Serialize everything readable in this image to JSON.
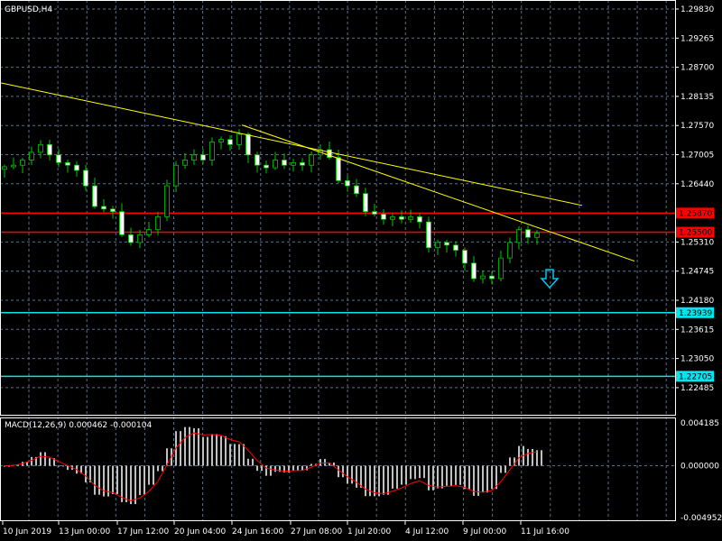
{
  "symbol_title": "GBPUSD,H4",
  "colors": {
    "background": "#000000",
    "grid": "#5f6f87",
    "bull": "#00c800",
    "bear_body": "#ffffff",
    "resistance": "#ff0000",
    "support": "#00e5ee",
    "trendline": "#ffff00",
    "macd_hist": "#c0c0c0",
    "signal": "#ff0000"
  },
  "chart_data": {
    "type": "candlestick",
    "price_ticks": [
      "1.29830",
      "1.29265",
      "1.28700",
      "1.28135",
      "1.27570",
      "1.27005",
      "1.26440",
      "1.25310",
      "1.24745",
      "1.24180",
      "1.23615",
      "1.23050",
      "1.22485"
    ],
    "price_range": [
      1.22,
      1.3
    ],
    "time_labels": [
      "10 Jun 2019",
      "13 Jun 00:00",
      "17 Jun 12:00",
      "20 Jun 04:00",
      "24 Jun 16:00",
      "27 Jun 08:00",
      "1 Jul 20:00",
      "4 Jul 12:00",
      "9 Jul 00:00",
      "11 Jul 16:00"
    ],
    "closes": [
      1.2677,
      1.268,
      1.269,
      1.2705,
      1.272,
      1.27,
      1.2685,
      1.268,
      1.267,
      1.264,
      1.26,
      1.2595,
      1.259,
      1.2545,
      1.253,
      1.2545,
      1.2555,
      1.258,
      1.264,
      1.268,
      1.269,
      1.27,
      1.269,
      1.2725,
      1.273,
      1.272,
      1.274,
      1.27,
      1.268,
      1.2675,
      1.269,
      1.268,
      1.2685,
      1.268,
      1.27,
      1.271,
      1.2695,
      1.265,
      1.264,
      1.2625,
      1.259,
      1.2585,
      1.2575,
      1.258,
      1.2575,
      1.258,
      1.257,
      1.252,
      1.253,
      1.2525,
      1.2515,
      1.249,
      1.246,
      1.2465,
      1.246,
      1.25,
      1.253,
      1.2555,
      1.254,
      1.2548
    ],
    "horizontal_levels": [
      {
        "price": "1.25870",
        "value": 1.2587,
        "kind": "resistance"
      },
      {
        "price": "1.25500",
        "value": 1.255,
        "kind": "resistance"
      },
      {
        "price": "1.23939",
        "value": 1.23939,
        "kind": "support"
      },
      {
        "price": "1.22705",
        "value": 1.22705,
        "kind": "support"
      }
    ],
    "trendlines": [
      {
        "from_price": 1.284,
        "to_price": 1.2602
      },
      {
        "from_price": 1.2758,
        "to_price": 1.2494
      }
    ],
    "signal_arrow": "down-arrow",
    "indicator": {
      "label": "MACD(12,26,9) 0.000462 -0.000104",
      "ticks": [
        "0.004185",
        "0.000000",
        "-0.004952"
      ],
      "range": [
        -0.004952,
        0.004185
      ]
    }
  }
}
